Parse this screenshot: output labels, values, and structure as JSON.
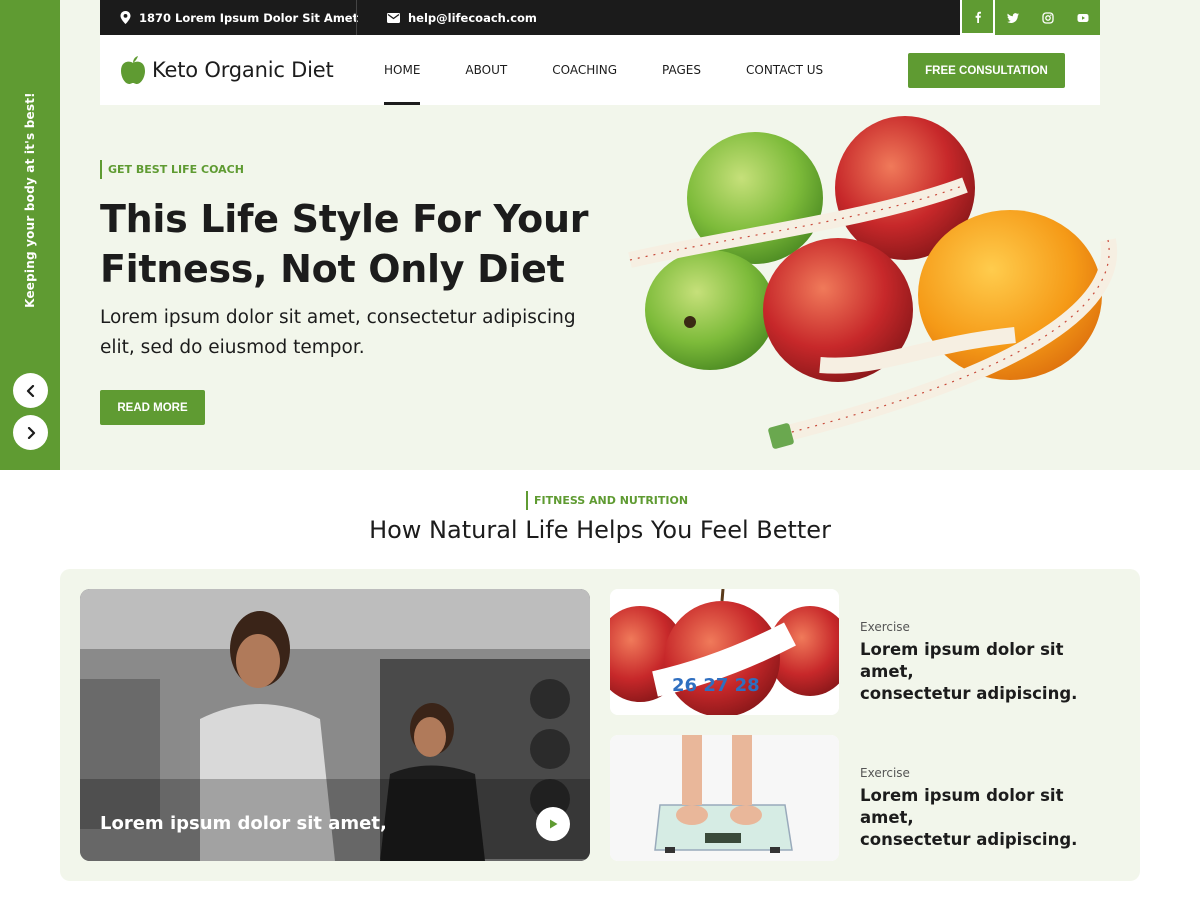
{
  "sidebar": {
    "tagline": "Keeping your body at it's best!",
    "prev_icon": "chevron-left-icon",
    "next_icon": "chevron-right-icon"
  },
  "topbar": {
    "address": "1870 Lorem Ipsum Dolor Sit Amet",
    "email": "help@lifecoach.com",
    "social": [
      "facebook-icon",
      "twitter-icon",
      "instagram-icon",
      "youtube-icon"
    ]
  },
  "nav": {
    "logo": "Keto Organic Diet",
    "items": [
      "HOME",
      "ABOUT",
      "COACHING",
      "PAGES",
      "CONTACT US"
    ],
    "active": "HOME",
    "cta": "FREE CONSULTATION"
  },
  "hero": {
    "eyebrow": "GET BEST LIFE COACH",
    "title_line1": "This Life Style For Your",
    "title_line2": "Fitness, Not Only Diet",
    "text_line1": "Lorem ipsum dolor sit amet, consectetur adipiscing",
    "text_line2": "elit, sed do eiusmod tempor.",
    "button": "READ MORE"
  },
  "section": {
    "eyebrow": "FITNESS AND NUTRITION",
    "title": "How Natural Life Helps You Feel Better",
    "feature_caption": "Lorem ipsum dolor sit amet,",
    "posts": [
      {
        "category": "Exercise",
        "title_line1": "Lorem ipsum dolor sit amet,",
        "title_line2": "consectetur adipiscing."
      },
      {
        "category": "Exercise",
        "title_line1": "Lorem ipsum dolor sit amet,",
        "title_line2": "consectetur adipiscing."
      }
    ]
  },
  "colors": {
    "accent": "#5f9b32",
    "dark": "#1b1b1b",
    "hero_bg": "#f2f6eb"
  }
}
